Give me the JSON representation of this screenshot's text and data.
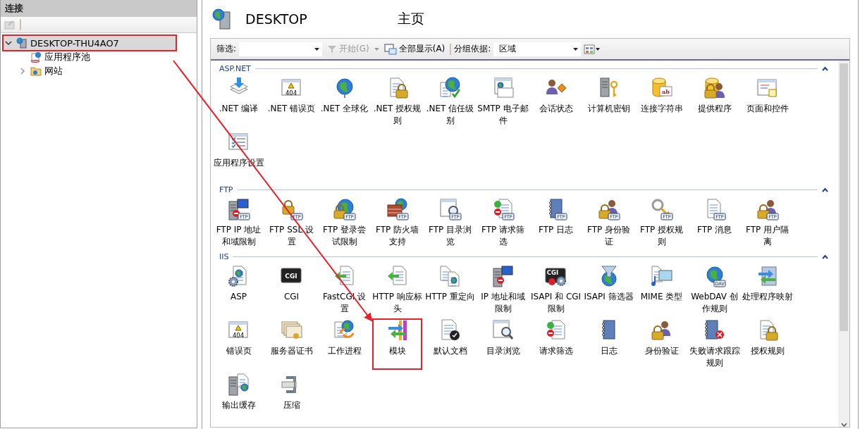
{
  "connections": {
    "title": "连接",
    "tree": [
      {
        "label": "DESKTOP-THU4AO7",
        "kind": "server",
        "expanded": true,
        "selected": true,
        "highlighted": true,
        "children": [
          {
            "label": "应用程序池",
            "kind": "pool",
            "selected": false,
            "highlighted": false
          },
          {
            "label": "网站",
            "kind": "sites",
            "expanded": false,
            "selected": false,
            "highlighted": false
          }
        ]
      }
    ]
  },
  "header": {
    "title": "DESKTOP",
    "subtitle": "主页"
  },
  "filter_bar": {
    "filter_label": "筛选:",
    "start": {
      "label": "开始(G)",
      "disabled": true
    },
    "show_all": {
      "label": "全部显示(A)",
      "disabled": false
    },
    "group_label": "分组依据:",
    "group_value": "区域"
  },
  "groups": [
    {
      "title": "ASP.NET",
      "expanded": true,
      "features": [
        {
          "label": ".NET 编译",
          "kind": "layers",
          "highlighted": false
        },
        {
          "label": ".NET 错误页",
          "kind": "warnwin",
          "icon_text": "404",
          "highlighted": false
        },
        {
          "label": ".NET 全球化",
          "kind": "globe",
          "highlighted": false
        },
        {
          "label": ".NET 授权规则",
          "kind": "doclock",
          "highlighted": false
        },
        {
          "label": ".NET 信任级别",
          "kind": "globedoc",
          "highlighted": false
        },
        {
          "label": "SMTP 电子邮件",
          "kind": "mail",
          "highlighted": false
        },
        {
          "label": "会话状态",
          "kind": "person",
          "highlighted": false
        },
        {
          "label": "计算机密钥",
          "kind": "serverkey",
          "highlighted": false
        },
        {
          "label": "连接字符串",
          "kind": "database",
          "icon_text": "ab",
          "highlighted": false
        },
        {
          "label": "提供程序",
          "kind": "dblock",
          "highlighted": false
        },
        {
          "label": "页面和控件",
          "kind": "window",
          "highlighted": false
        },
        {
          "label": "应用程序设置",
          "kind": "checklist",
          "highlighted": false
        }
      ]
    },
    {
      "title": "FTP",
      "expanded": true,
      "features": [
        {
          "label": "FTP IP 地址和域限制",
          "kind": "server",
          "icon_text": "FTP",
          "highlighted": false
        },
        {
          "label": "FTP SSL 设置",
          "kind": "lock",
          "icon_text": "FTP",
          "highlighted": false
        },
        {
          "label": "FTP 登录尝试限制",
          "kind": "globelock",
          "icon_text": "FTP",
          "highlighted": false
        },
        {
          "label": "FTP 防火墙支持",
          "kind": "wall",
          "icon_text": "FTP",
          "highlighted": false
        },
        {
          "label": "FTP 目录浏览",
          "kind": "magnifier",
          "icon_text": "FTP",
          "highlighted": false
        },
        {
          "label": "FTP 请求筛选",
          "kind": "filterlist",
          "icon_text": "FTP",
          "highlighted": false
        },
        {
          "label": "FTP 日志",
          "kind": "book",
          "icon_text": "FTP",
          "highlighted": false
        },
        {
          "label": "FTP 身份验证",
          "kind": "personlock",
          "icon_text": "FTP",
          "highlighted": false
        },
        {
          "label": "FTP 授权规则",
          "kind": "key",
          "icon_text": "FTP",
          "highlighted": false
        },
        {
          "label": "FTP 消息",
          "kind": "doc",
          "icon_text": "FTP",
          "highlighted": false
        },
        {
          "label": "FTP 用户隔离",
          "kind": "personlock",
          "icon_text": "FTP",
          "highlighted": false
        }
      ]
    },
    {
      "title": "IIS",
      "expanded": true,
      "features": [
        {
          "label": "ASP",
          "kind": "docgear",
          "highlighted": false
        },
        {
          "label": "CGI",
          "kind": "terminal",
          "icon_text": "CGI",
          "highlighted": false
        },
        {
          "label": "FastCGI 设置",
          "kind": "arrowdoc",
          "highlighted": false
        },
        {
          "label": "HTTP 响应标头",
          "kind": "arrowdoc",
          "highlighted": false
        },
        {
          "label": "HTTP 重定向",
          "kind": "docs",
          "highlighted": false
        },
        {
          "label": "IP 地址和域限制",
          "kind": "server",
          "highlighted": false
        },
        {
          "label": "ISAPI 和 CGI 限制",
          "kind": "terminalgear",
          "icon_text": "CGI",
          "highlighted": false
        },
        {
          "label": "ISAPI 筛选器",
          "kind": "funnel",
          "highlighted": false
        },
        {
          "label": "MIME 类型",
          "kind": "media",
          "highlighted": false
        },
        {
          "label": "WebDAV 创作规则",
          "kind": "globe",
          "icon_text": "DAV",
          "highlighted": false
        },
        {
          "label": "处理程序映射",
          "kind": "arrows",
          "highlighted": false
        },
        {
          "label": "错误页",
          "kind": "warnwin",
          "icon_text": "404",
          "highlighted": false
        },
        {
          "label": "服务器证书",
          "kind": "certificate",
          "highlighted": false
        },
        {
          "label": "工作进程",
          "kind": "recycle",
          "highlighted": false
        },
        {
          "label": "模块",
          "kind": "modules",
          "highlighted": true
        },
        {
          "label": "默认文档",
          "kind": "doccheck",
          "highlighted": false
        },
        {
          "label": "目录浏览",
          "kind": "magnifier",
          "highlighted": false
        },
        {
          "label": "请求筛选",
          "kind": "filterlist",
          "highlighted": false
        },
        {
          "label": "日志",
          "kind": "book",
          "highlighted": false
        },
        {
          "label": "身份验证",
          "kind": "personlock",
          "highlighted": false
        },
        {
          "label": "失败请求跟踪规则",
          "kind": "bookx",
          "highlighted": false
        },
        {
          "label": "授权规则",
          "kind": "doclock",
          "highlighted": false
        },
        {
          "label": "输出缓存",
          "kind": "serverdoc",
          "highlighted": false
        },
        {
          "label": "压缩",
          "kind": "clamp",
          "highlighted": false
        }
      ]
    }
  ]
}
